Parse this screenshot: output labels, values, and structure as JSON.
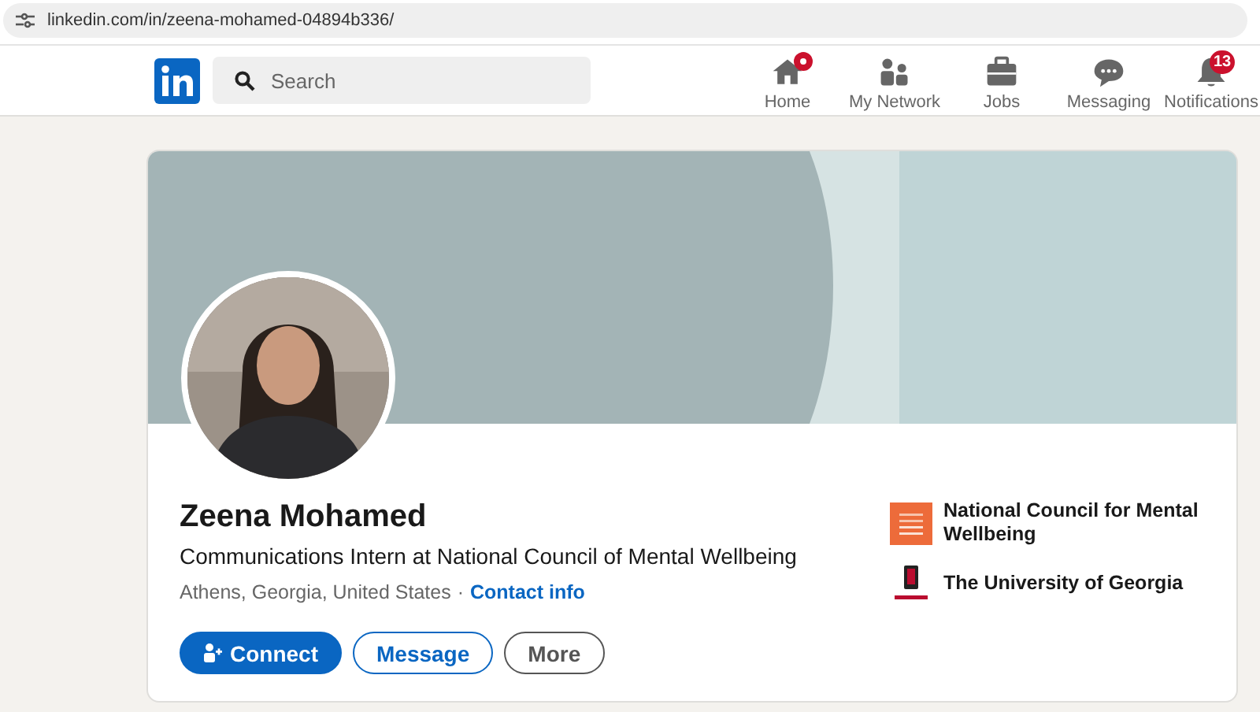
{
  "browser": {
    "url": "linkedin.com/in/zeena-mohamed-04894b336/"
  },
  "nav": {
    "search": {
      "placeholder": "Search"
    },
    "items": [
      {
        "label": "Home",
        "kind": "home",
        "dot": true
      },
      {
        "label": "My Network",
        "kind": "network",
        "dot": false
      },
      {
        "label": "Jobs",
        "kind": "jobs",
        "dot": false
      },
      {
        "label": "Messaging",
        "kind": "messaging",
        "dot": false
      },
      {
        "label": "Notifications",
        "kind": "notifications",
        "dot": false,
        "badge": "13"
      }
    ]
  },
  "profile": {
    "name": "Zeena Mohamed",
    "headline": "Communications Intern at National Council of Mental Wellbeing",
    "location": "Athens, Georgia, United States",
    "separator": "·",
    "contact_link": "Contact info",
    "actions": [
      {
        "label": "Connect",
        "kind": "primary"
      },
      {
        "label": "Message",
        "kind": "secondary"
      },
      {
        "label": "More",
        "kind": "tertiary"
      }
    ],
    "organizations": [
      {
        "name": "National Council for Mental Wellbeing",
        "kind": "company"
      },
      {
        "name": "The University of Georgia",
        "kind": "school"
      }
    ]
  }
}
